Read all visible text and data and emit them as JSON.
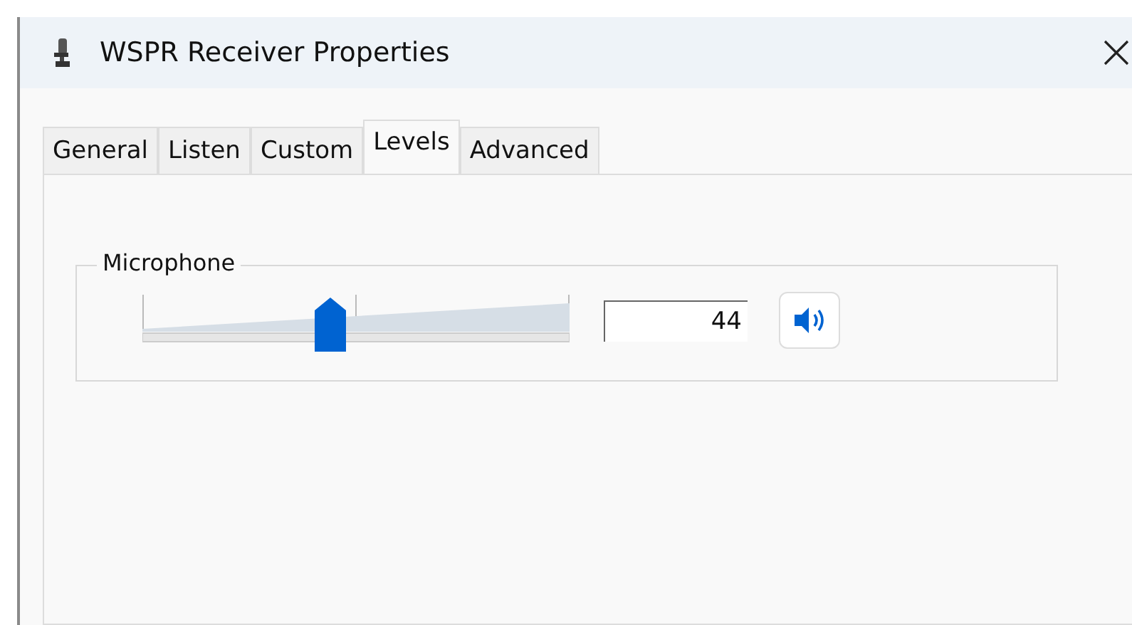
{
  "window": {
    "title": "WSPR Receiver Properties"
  },
  "tabs": [
    {
      "label": "General",
      "selected": false
    },
    {
      "label": "Listen",
      "selected": false
    },
    {
      "label": "Custom",
      "selected": false
    },
    {
      "label": "Levels",
      "selected": true
    },
    {
      "label": "Advanced",
      "selected": false
    }
  ],
  "group": {
    "title": "Microphone",
    "slider": {
      "level": 0.44
    },
    "value": "44",
    "muted": false
  }
}
